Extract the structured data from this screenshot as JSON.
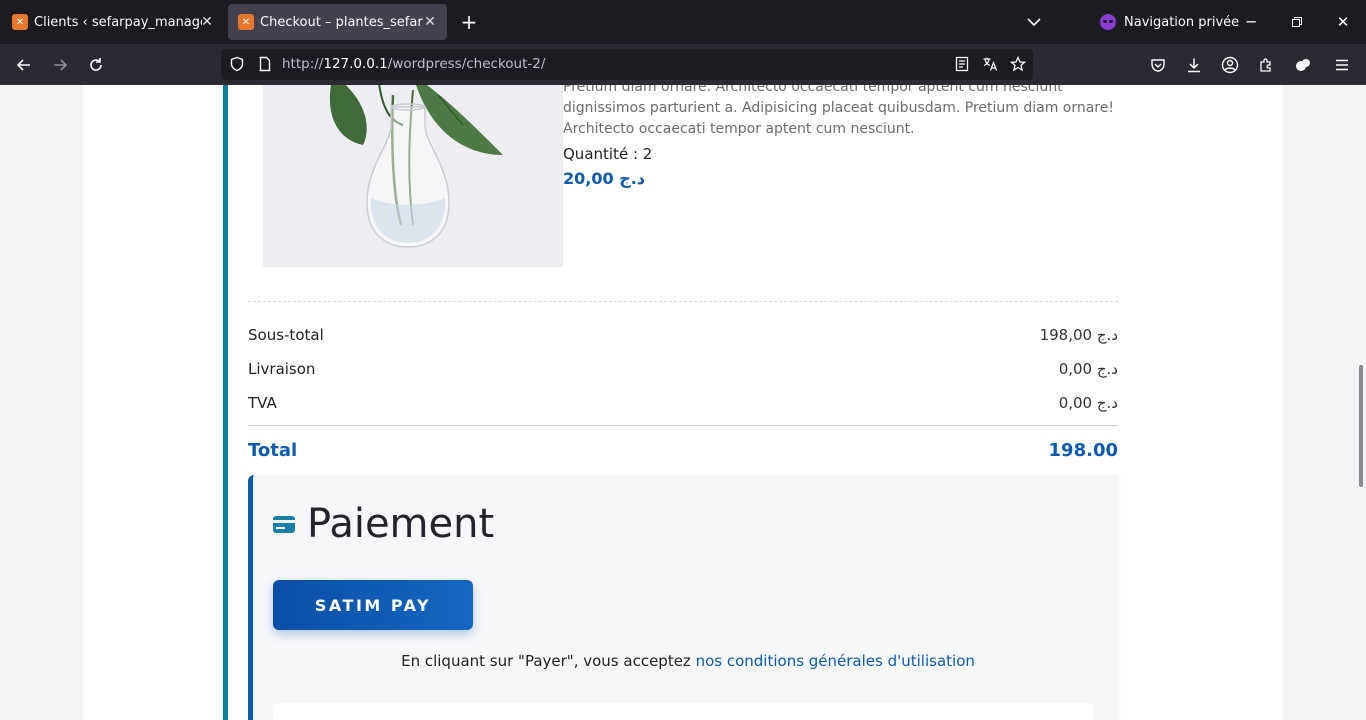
{
  "browser": {
    "tabs": [
      {
        "title": "Clients ‹ sefarpay_management — WordPress",
        "active": false
      },
      {
        "title": "Checkout – plantes_sefar",
        "active": true
      }
    ],
    "private_label": "Navigation privée",
    "url_prefix": "http://",
    "url_host": "127.0.0.1",
    "url_path": "/wordpress/checkout-2/"
  },
  "product": {
    "description": "Pretium diam ornare. Architecto occaecati tempor aptent cum nesciunt dignissimos parturient a. Adipisicing placeat quibusdam. Pretium diam ornare! Architecto occaecati tempor aptent cum nesciunt.",
    "quantity_label": "Quantité : 2",
    "price": "20,00 د.ج"
  },
  "summary": {
    "subtotal_label": "Sous-total",
    "subtotal_value": "198,00 د.ج",
    "shipping_label": "Livraison",
    "shipping_value": "0,00 د.ج",
    "tax_label": "TVA",
    "tax_value": "0,00 د.ج",
    "total_label": "Total",
    "total_value": "198.00"
  },
  "payment": {
    "title": "Paiement",
    "button_label": "SATIM PAY",
    "terms_prefix": "En cliquant sur \"Payer\", vous acceptez ",
    "terms_link": "nos conditions générales d'utilisation"
  },
  "colors": {
    "accent": "#0d5bb0",
    "side_border": "#0f7ea0",
    "tab_bar": "#1c1b22",
    "nav_bar": "#2b2a33"
  }
}
